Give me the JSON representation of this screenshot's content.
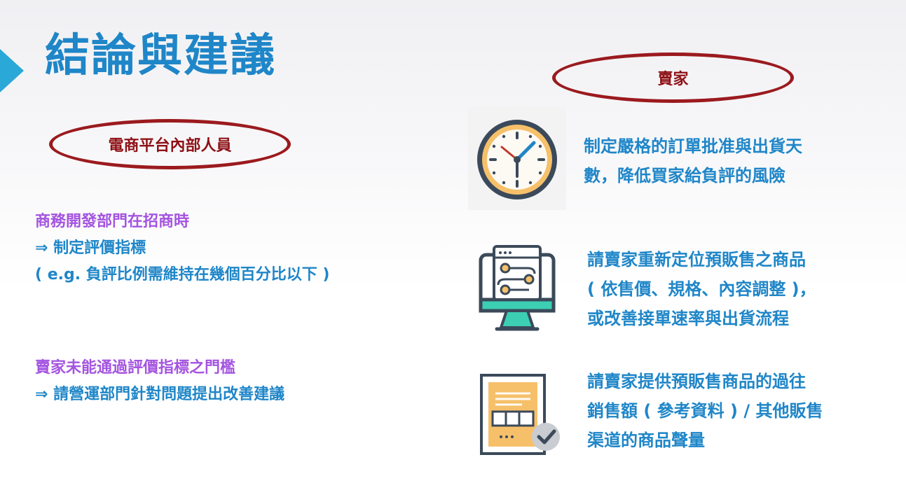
{
  "slide": {
    "title": "結論與建議",
    "left_group_label": "電商平台內部人員",
    "right_group_label": "賣家",
    "left_blocks": [
      {
        "head": "商務開發部門在招商時",
        "lines": [
          "⇒ 制定評價指標",
          "( e.g. 負評比例需維持在幾個百分比以下 )"
        ]
      },
      {
        "head": "賣家未能通過評價指標之門檻",
        "lines": [
          "⇒ 請營運部門針對問題提出改善建議"
        ]
      }
    ],
    "right_items": [
      {
        "icon": "clock-icon",
        "lines": [
          "制定嚴格的訂單批准與出貨天",
          "數，降低買家給負評的風險"
        ]
      },
      {
        "icon": "monitor-process-icon",
        "lines": [
          "請賣家重新定位預販售之商品",
          "( 依售價、規格、內容調整 )，",
          "或改善接單速率與出貨流程"
        ]
      },
      {
        "icon": "document-check-icon",
        "lines": [
          "請賣家提供預販售商品的過往",
          "銷售額 ( 參考資料 ) / 其他販售",
          "渠道的商品聲量"
        ]
      }
    ]
  },
  "colors": {
    "title": "#1f86c8",
    "accent_arrow": "#2aa8d8",
    "oval_border": "#9b1a1e",
    "oval_text": "#8e1116",
    "left_head": "#a454e0",
    "body_text": "#1f86c8"
  }
}
